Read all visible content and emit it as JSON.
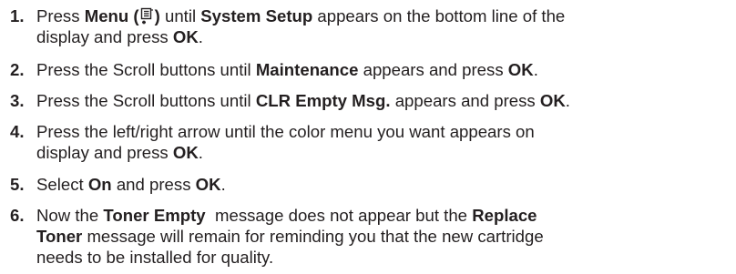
{
  "steps": [
    {
      "number": "1.",
      "t1": "Press ",
      "b1": "Menu (",
      "icon": "menu-icon",
      "b2": ")",
      "t2": " until ",
      "b3": "System Setup",
      "t3": " appears on the bottom line of the",
      "line2": "display and press ",
      "b4": "OK",
      "t4": "."
    },
    {
      "number": "2.",
      "t1": "Press the Scroll buttons until ",
      "b1": "Maintenance",
      "t2": " appears and press ",
      "b2": "OK",
      "t3": "."
    },
    {
      "number": "3.",
      "t1": "Press the Scroll buttons until ",
      "b1": "CLR Empty Msg.",
      "t2": " appears and press ",
      "b2": "OK",
      "t3": "."
    },
    {
      "number": "4.",
      "t1": "Press the left/right arrow until the color menu you want appears on",
      "line2": "display and press ",
      "b1": "OK",
      "t2": "."
    },
    {
      "number": "5.",
      "t1": "Select ",
      "b1": "On",
      "t2": " and press ",
      "b2": "OK",
      "t3": "."
    },
    {
      "number": "6.",
      "t1": "Now the ",
      "b1": "Toner Empty",
      "t2": "  message does not appear but the ",
      "b2": "Replace",
      "b3": "Toner",
      "t3": " message will remain for reminding you that the new cartridge",
      "line3": "needs to be installed for quality."
    }
  ]
}
